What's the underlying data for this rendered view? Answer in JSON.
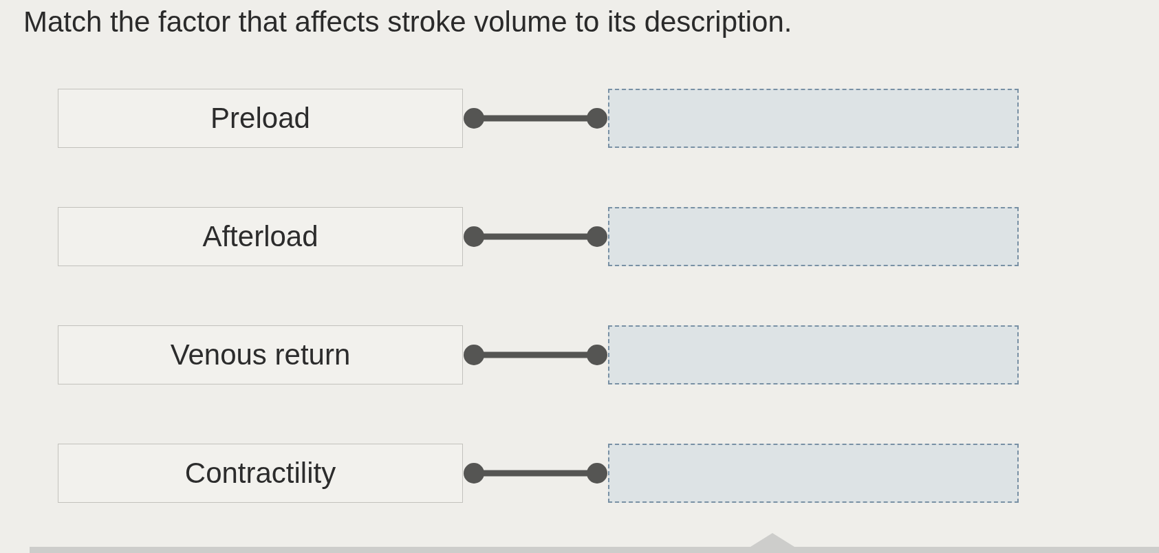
{
  "question": {
    "text": "Match the factor that affects stroke volume to its description."
  },
  "pairs": [
    {
      "term": "Preload"
    },
    {
      "term": "Afterload"
    },
    {
      "term": "Venous return"
    },
    {
      "term": "Contractility"
    }
  ]
}
